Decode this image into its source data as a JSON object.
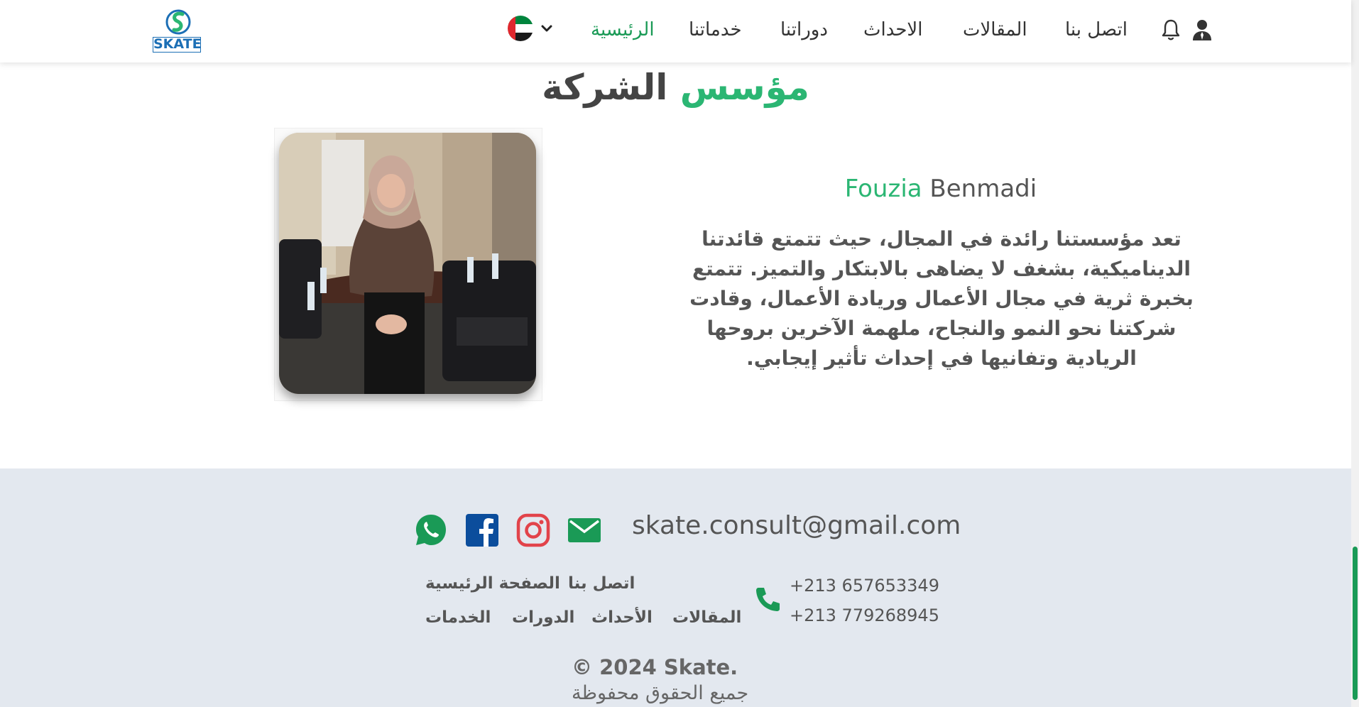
{
  "header": {
    "logo_text": "SKATE",
    "nav": {
      "home": "الرئيسية",
      "services": "خدماتنا",
      "courses": "دوراتنا",
      "events": "الاحداث",
      "articles": "المقالات",
      "contact": "اتصل بنا"
    },
    "language_flag": "uae-flag-icon",
    "icons": [
      "chevron-down-icon",
      "bell-icon",
      "user-icon"
    ]
  },
  "founder": {
    "title_part1": "مؤسس",
    "title_part2": "الشركة",
    "first_name": "Fouzia",
    "last_name": "Benmadi",
    "bio": "تعد مؤسستنا رائدة في المجال، حيث تتمتع قائدتنا الديناميكية، بشغف لا يضاهى بالابتكار والتميز. تتمتع بخبرة ثرية في مجال الأعمال وريادة الأعمال، وقادت شركتنا نحو النمو والنجاح، ملهمة الآخرين بروحها الريادية وتفانيها في إحداث تأثير إيجابي."
  },
  "footer": {
    "email": "skate.consult@gmail.com",
    "phones": [
      "+213 657653349",
      "+213 779268945"
    ],
    "links": {
      "home": "الصفحة الرئيسية",
      "contact": "اتصل بنا",
      "articles": "المقالات",
      "events": "الأحداث",
      "courses": "الدورات",
      "services": "الخدمات"
    },
    "copyright": "© 2024 Skate.",
    "rights": "جميع الحقوق محفوظة"
  },
  "colors": {
    "brand_green": "#2bb673",
    "nav_active": "#1a9a56",
    "footer_bg": "#e3e8ef",
    "logo_blue": "#1c6fb5"
  }
}
